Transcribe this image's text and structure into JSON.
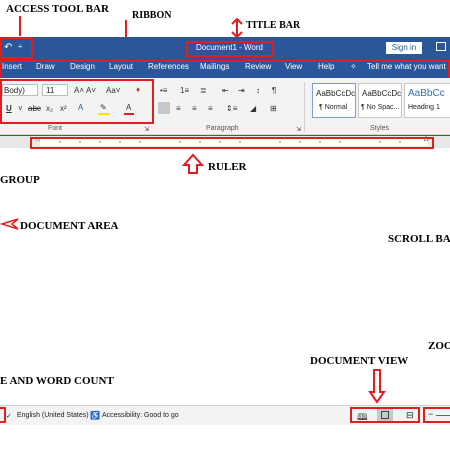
{
  "annotations": {
    "quick_access": "ACCESS TOOL BAR",
    "ribbon": "RIBBON",
    "title_bar": "TITLE BAR",
    "ruler": "RULER",
    "group": "GROUP",
    "document_area": "DOCUMENT AREA",
    "scroll_bar": "SCROLL BA",
    "zoom": "ZOO",
    "document_view": "DOCUMENT VIEW",
    "page_word_count": "E AND WORD COUNT"
  },
  "titlebar": {
    "doc_title": "Document1  -  Word",
    "sign_in": "Sign in",
    "qat_icon1": "↶",
    "qat_dropdown": "÷"
  },
  "tabs": {
    "insert": "Insert",
    "draw": "Draw",
    "design": "Design",
    "layout": "Layout",
    "references": "References",
    "mailings": "Mailings",
    "review": "Review",
    "view": "View",
    "help": "Help",
    "tell_me": "Tell me what you want to"
  },
  "ribbon": {
    "font_name": "Body)",
    "font_size": "11",
    "font_group": "Font",
    "paragraph_group": "Paragraph",
    "styles_group": "Styles",
    "styles": [
      {
        "preview": "AaBbCcDc",
        "name": "¶ Normal"
      },
      {
        "preview": "AaBbCcDc",
        "name": "¶ No Spac..."
      },
      {
        "preview": "AaBbCc",
        "name": "Heading 1"
      }
    ]
  },
  "statusbar": {
    "language": "English (United States)",
    "accessibility": "Accessibility: Good to go"
  },
  "colors": {
    "word_blue": "#2b579a",
    "annotation_red": "#e01e1e",
    "ribbon_bg": "#f3f3f3"
  }
}
